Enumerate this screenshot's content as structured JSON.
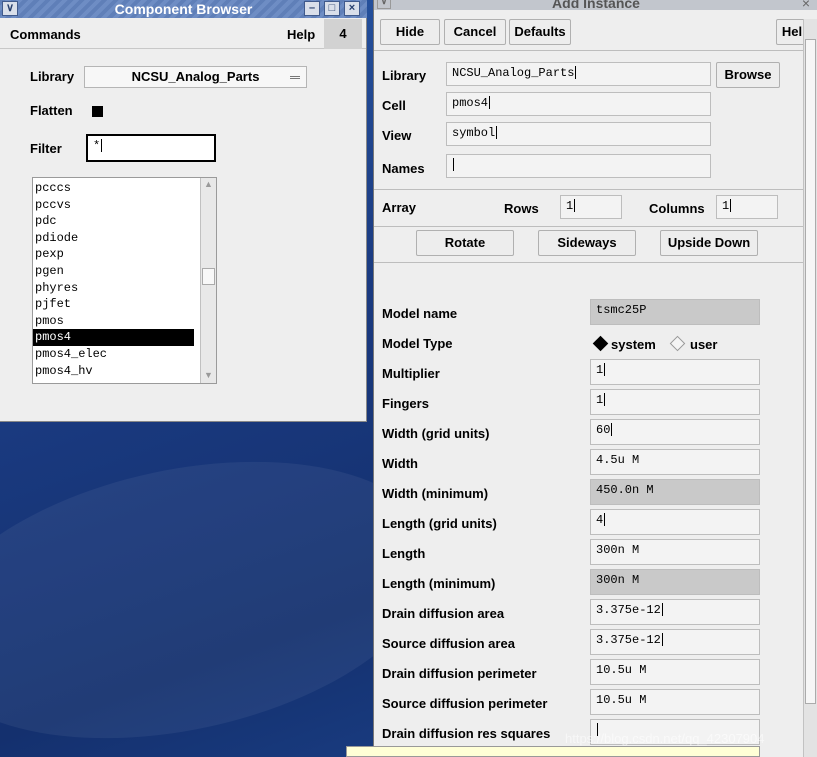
{
  "component_browser": {
    "title": "Component Browser",
    "menu": {
      "commands": "Commands",
      "help": "Help",
      "page": "4"
    },
    "library_label": "Library",
    "library_value": "NCSU_Analog_Parts",
    "flatten_label": "Flatten",
    "filter_label": "Filter",
    "filter_value": "*",
    "cells": [
      "pcccs",
      "pccvs",
      "pdc",
      "pdiode",
      "pexp",
      "pgen",
      "phyres",
      "pjfet",
      "pmos",
      "pmos4",
      "pmos4_elec",
      "pmos4_hv"
    ],
    "selected_cell": "pmos4"
  },
  "add_instance": {
    "title": "Add Instance",
    "buttons": {
      "hide": "Hide",
      "cancel": "Cancel",
      "defaults": "Defaults",
      "help": "Help",
      "browse": "Browse"
    },
    "library": {
      "label": "Library",
      "value": "NCSU_Analog_Parts"
    },
    "cell": {
      "label": "Cell",
      "value": "pmos4"
    },
    "view": {
      "label": "View",
      "value": "symbol"
    },
    "names": {
      "label": "Names",
      "value": ""
    },
    "array": {
      "label": "Array",
      "rows_label": "Rows",
      "rows": "1",
      "columns_label": "Columns",
      "columns": "1"
    },
    "transform": {
      "rotate": "Rotate",
      "sideways": "Sideways",
      "upside_down": "Upside Down"
    },
    "params": [
      {
        "label": "Model name",
        "value": "tsmc25P",
        "readonly": true
      },
      {
        "label": "Model Type",
        "type": "radio",
        "options": [
          "system",
          "user"
        ],
        "selected": "system"
      },
      {
        "label": "Multiplier",
        "value": "1"
      },
      {
        "label": "Fingers",
        "value": "1"
      },
      {
        "label": "Width (grid units)",
        "value": "60"
      },
      {
        "label": "Width",
        "value": "4.5u M"
      },
      {
        "label": "Width (minimum)",
        "value": "450.0n M",
        "readonly": true
      },
      {
        "label": "Length (grid units)",
        "value": "4"
      },
      {
        "label": "Length",
        "value": "300n M"
      },
      {
        "label": "Length (minimum)",
        "value": "300n M",
        "readonly": true
      },
      {
        "label": "Drain diffusion area",
        "value": "3.375e-12"
      },
      {
        "label": "Source diffusion area",
        "value": "3.375e-12"
      },
      {
        "label": "Drain diffusion perimeter",
        "value": "10.5u M"
      },
      {
        "label": "Source diffusion perimeter",
        "value": "10.5u M"
      },
      {
        "label": "Drain diffusion res squares",
        "value": ""
      }
    ]
  },
  "watermark": "https://blog.csdn.net/qq_42307904"
}
